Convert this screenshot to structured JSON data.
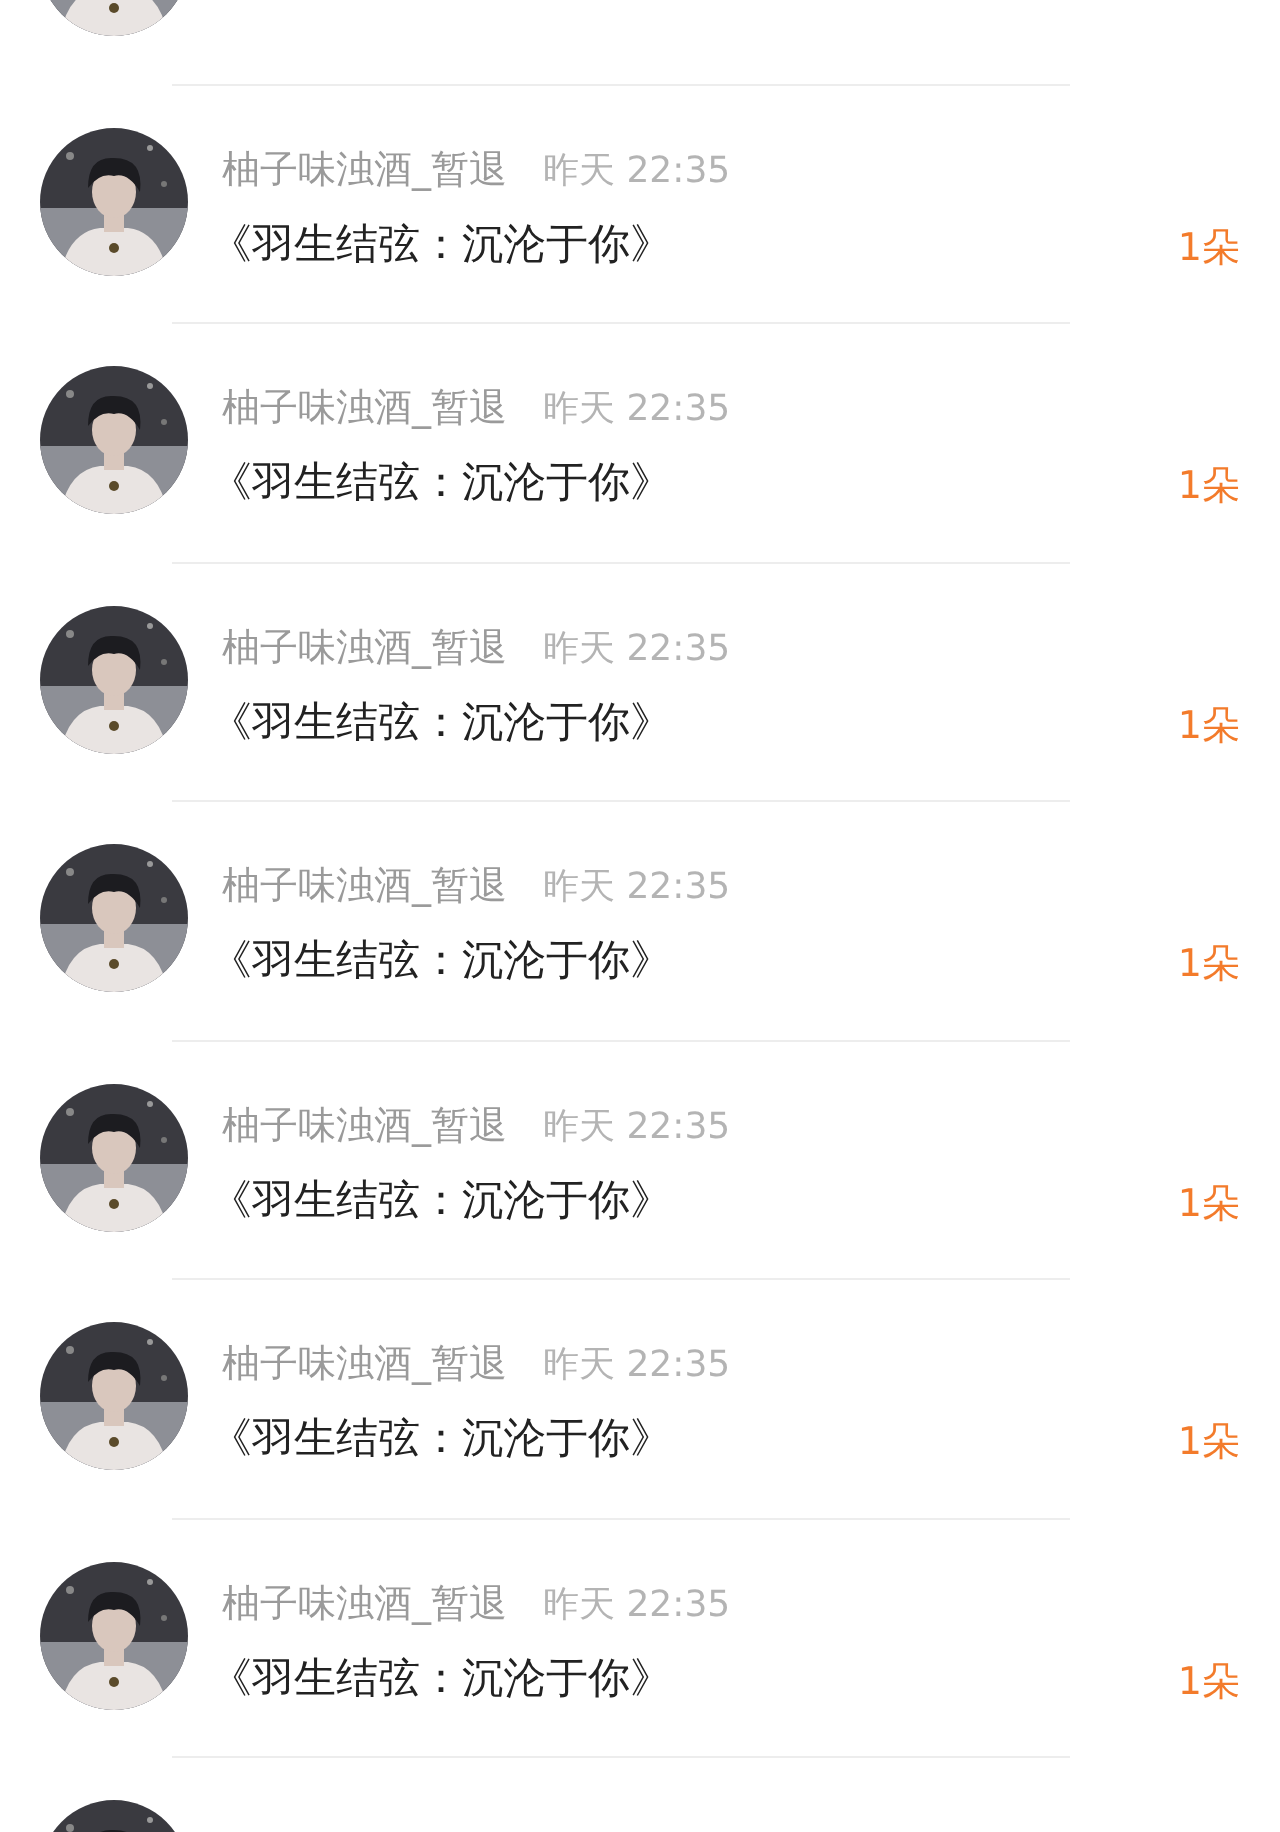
{
  "messages": [
    {
      "name": "柚子味浊酒_暂退",
      "time": "昨天 22:35",
      "title": "《羽生结弦：沉沦于你》",
      "count": "1朵"
    },
    {
      "name": "柚子味浊酒_暂退",
      "time": "昨天 22:35",
      "title": "《羽生结弦：沉沦于你》",
      "count": "1朵"
    },
    {
      "name": "柚子味浊酒_暂退",
      "time": "昨天 22:35",
      "title": "《羽生结弦：沉沦于你》",
      "count": "1朵"
    },
    {
      "name": "柚子味浊酒_暂退",
      "time": "昨天 22:35",
      "title": "《羽生结弦：沉沦于你》",
      "count": "1朵"
    },
    {
      "name": "柚子味浊酒_暂退",
      "time": "昨天 22:35",
      "title": "《羽生结弦：沉沦于你》",
      "count": "1朵"
    },
    {
      "name": "柚子味浊酒_暂退",
      "time": "昨天 22:35",
      "title": "《羽生结弦：沉沦于你》",
      "count": "1朵"
    },
    {
      "name": "柚子味浊酒_暂退",
      "time": "昨天 22:35",
      "title": "《羽生结弦：沉沦于你》",
      "count": "1朵"
    }
  ]
}
